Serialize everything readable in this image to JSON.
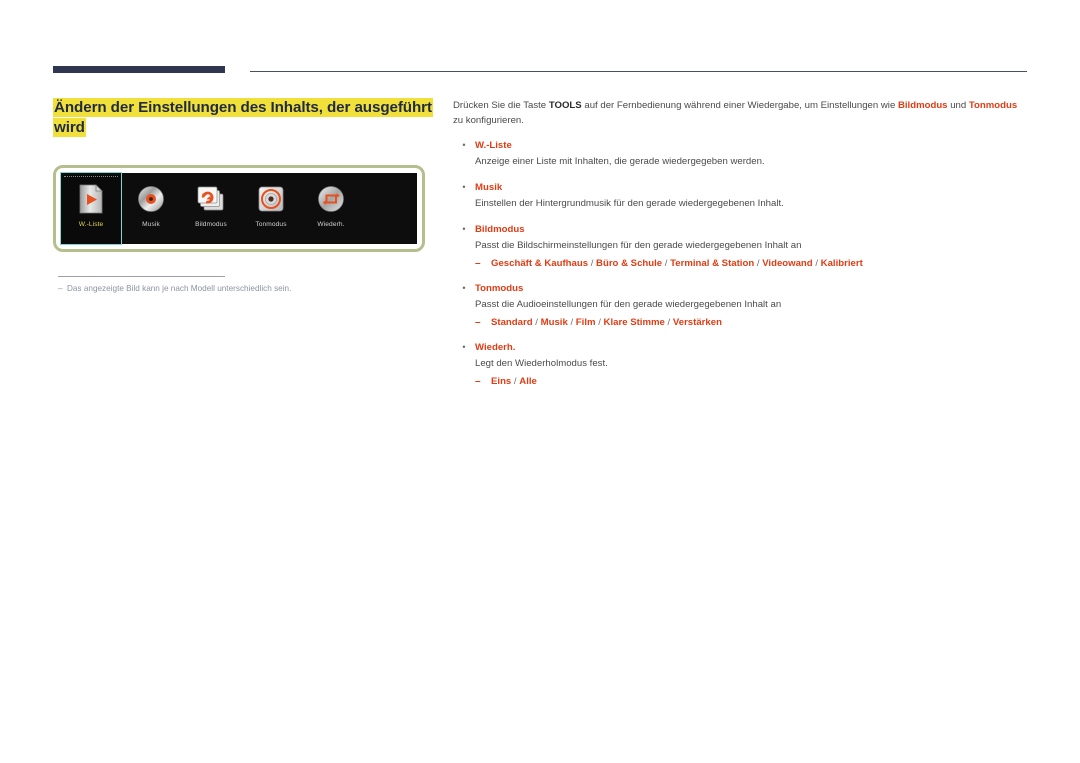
{
  "header": {
    "rule_color": "#2e3650",
    "thin_rule_color": "#4a4f63"
  },
  "page_title": {
    "text": "Ändern der Einstellungen des Inhalts, der ausgeführt wird",
    "highlight_color": "#f2e03a",
    "text_color": "#1f2a44"
  },
  "figure": {
    "border_color": "#b5bf8e",
    "screen_background": "#0d0d0d",
    "selected_outline_color": "#7fd4d4",
    "selected_label_color": "#e2d45a",
    "items": [
      {
        "label": "W.-Liste",
        "icon": "playlist-file-icon",
        "selected": true
      },
      {
        "label": "Musik",
        "icon": "music-disc-icon",
        "selected": false
      },
      {
        "label": "Bildmodus",
        "icon": "picture-mode-icon",
        "selected": false
      },
      {
        "label": "Tonmodus",
        "icon": "sound-mode-icon",
        "selected": false
      },
      {
        "label": "Wiederh.",
        "icon": "repeat-icon",
        "selected": false
      }
    ]
  },
  "note": {
    "dash": "–",
    "text": "Das angezeigte Bild kann je nach Modell unterschiedlich sein."
  },
  "content": {
    "accent_color": "#e03c14",
    "intro": {
      "part1": "Drücken Sie die Taste ",
      "tools": "TOOLS",
      "part2": " auf der Fernbedienung während einer Wiedergabe, um Einstellungen wie ",
      "bildmodus": "Bildmodus",
      "part3": " und ",
      "tonmodus": "Tonmodus",
      "part4": " zu konfigurieren."
    },
    "bullet_marker": "•",
    "sub_marker": "–",
    "items": [
      {
        "title": "W.-Liste",
        "desc": "Anzeige einer Liste mit Inhalten, die gerade wiedergegeben werden.",
        "options": []
      },
      {
        "title": "Musik",
        "desc": "Einstellen der Hintergrundmusik für den gerade wiedergegebenen Inhalt.",
        "options": []
      },
      {
        "title": "Bildmodus",
        "desc": "Passt die Bildschirmeinstellungen für den gerade wiedergegebenen Inhalt an",
        "options": [
          "Geschäft & Kaufhaus",
          "Büro & Schule",
          "Terminal & Station",
          "Videowand",
          "Kalibriert"
        ]
      },
      {
        "title": "Tonmodus",
        "desc": "Passt die Audioeinstellungen für den gerade wiedergegebenen Inhalt an",
        "options": [
          "Standard",
          "Musik",
          "Film",
          "Klare Stimme",
          "Verstärken"
        ]
      },
      {
        "title": "Wiederh.",
        "desc": "Legt den Wiederholmodus fest.",
        "options": [
          "Eins",
          "Alle"
        ]
      }
    ]
  }
}
